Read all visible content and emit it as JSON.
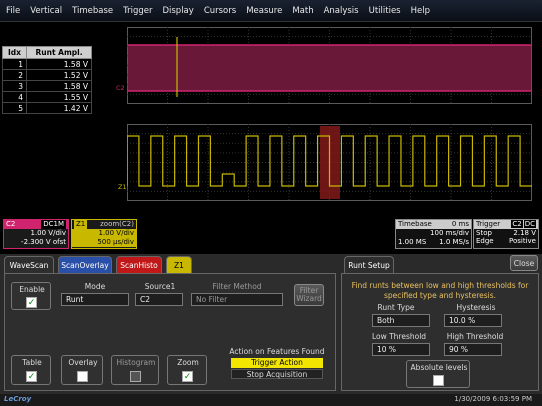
{
  "menu": [
    "File",
    "Vertical",
    "Timebase",
    "Trigger",
    "Display",
    "Cursors",
    "Measure",
    "Math",
    "Analysis",
    "Utilities",
    "Help"
  ],
  "runt_table": {
    "headers": [
      "Idx",
      "Runt Ampl."
    ],
    "rows": [
      [
        "1",
        "1.58 V"
      ],
      [
        "2",
        "1.52 V"
      ],
      [
        "3",
        "1.58 V"
      ],
      [
        "4",
        "1.55 V"
      ],
      [
        "5",
        "1.42 V"
      ]
    ]
  },
  "traces": {
    "c2_marker": "C2",
    "z1_marker": "Z1"
  },
  "channels": {
    "c2": {
      "name": "C2",
      "mode": "DC1M",
      "vdiv": "1.00 V/div",
      "offset": "-2.300 V ofst",
      "color": "#d0256e"
    },
    "z1": {
      "name": "Z1",
      "title": "zoom(C2)",
      "vdiv": "1.00 V/div",
      "tdiv": "500 µs/div",
      "color": "#c8b800"
    }
  },
  "timebase": {
    "label": "Timebase",
    "delay": "0 ms",
    "tdiv": "100 ms/div",
    "samples": "1.00 MS",
    "rate": "1.0 MS/s"
  },
  "trigger": {
    "label": "Trigger",
    "ch": "C2",
    "coupling": "DC",
    "mode": "Stop",
    "level": "2.18 V",
    "type": "Edge",
    "slope": "Positive"
  },
  "tabs": {
    "wavescan": "WaveScan",
    "scanoverlay": "ScanOverlay",
    "scanhisto": "ScanHisto",
    "z1": "Z1",
    "runtsetup": "Runt Setup",
    "close": "Close"
  },
  "wavescan": {
    "enable": "Enable",
    "mode_label": "Mode",
    "mode_value": "Runt",
    "source_label": "Source1",
    "source_value": "C2",
    "filter_label": "Filter Method",
    "filter_value": "No Filter",
    "filter_wizard": "Filter Wizard",
    "table": "Table",
    "overlay": "Overlay",
    "histogram": "Histogram",
    "zoom": "Zoom",
    "action_label": "Action on Features Found",
    "action_1": "Trigger Action",
    "action_2": "Stop Acquisition"
  },
  "runt_setup": {
    "desc": "Find runts between low and high thresholds for specified type and hysteresis.",
    "runt_type_label": "Runt Type",
    "runt_type_value": "Both",
    "hyst_label": "Hysteresis",
    "hyst_value": "10.0 %",
    "low_label": "Low Threshold",
    "low_value": "10 %",
    "high_label": "High Threshold",
    "high_value": "90 %",
    "abs_label": "Absolute levels"
  },
  "status": {
    "brand": "LeCroy",
    "datetime": "1/30/2009 6:03:59 PM"
  },
  "chart_data": {
    "type": "line",
    "c2_pulse_levels": [
      1,
      0,
      1,
      0,
      1,
      0,
      1,
      0,
      1,
      0,
      1,
      0,
      1,
      0,
      1,
      0,
      1,
      0,
      1,
      0,
      1,
      0,
      1,
      0
    ],
    "zoom_pulses": [
      1,
      0,
      1,
      0,
      1,
      0,
      1,
      0,
      2,
      0,
      1,
      0,
      1,
      0,
      1,
      0,
      1,
      0,
      1,
      0,
      1,
      0,
      1,
      0,
      1,
      0,
      1,
      0,
      1,
      0,
      1,
      0,
      1,
      0
    ]
  }
}
